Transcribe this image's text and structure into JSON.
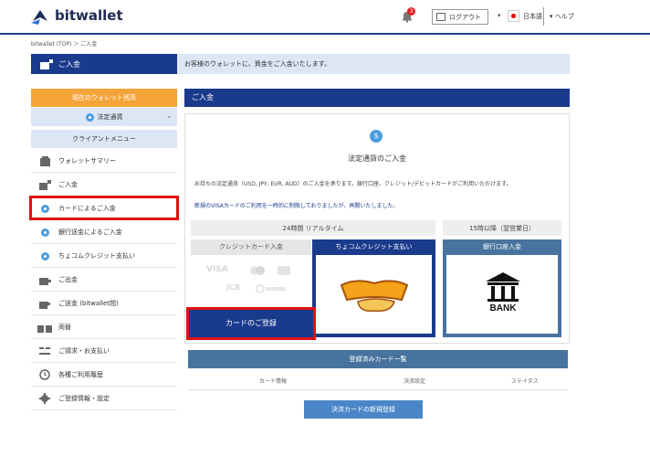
{
  "header": {
    "logo_text": "bitwallet",
    "notification_count": "3",
    "logout_label": "ログアウト",
    "language_label": "日本語",
    "help_label": "ヘルプ"
  },
  "breadcrumb": "bitwallet (TOP) ＞ ご入金",
  "page_banner": {
    "title": "ご入金",
    "message": "お客様のウォレットに、資金をご入金いたします。"
  },
  "sidebar": {
    "wallet_header": "現在のウォレット残高",
    "wallet_selected": "法定通貨",
    "client_menu_header": "クライアントメニュー",
    "items": [
      {
        "label": "ウォレットサマリー",
        "icon": "building-icon"
      },
      {
        "label": "ご入金",
        "icon": "deposit-icon"
      },
      {
        "label": "カードによるご入金",
        "icon": "bullet-icon"
      },
      {
        "label": "銀行送金によるご入金",
        "icon": "bullet-icon"
      },
      {
        "label": "ちょコムクレジット支払い",
        "icon": "bullet-icon"
      },
      {
        "label": "ご出金",
        "icon": "withdraw-icon"
      },
      {
        "label": "ご送金 (bitwallet間)",
        "icon": "transfer-icon"
      },
      {
        "label": "両替",
        "icon": "exchange-icon"
      },
      {
        "label": "ご請求・お支払い",
        "icon": "billing-icon"
      },
      {
        "label": "各種ご利用履歴",
        "icon": "history-icon"
      },
      {
        "label": "ご登録情報・設定",
        "icon": "gear-icon"
      }
    ]
  },
  "main": {
    "title": "ご入金",
    "deposit_heading": "法定通貨のご入金",
    "description": "お持ちの法定通貨（USD, JPY, EUR, AUD）のご入金を承ります。銀行口座、クレジット/デビットカードがご利用いただけます。",
    "notice": "新規のVISAカードのご利用を一時的に制限しておりましたが、再開いたしました。",
    "availability_realtime": "24時間 リアルタイム",
    "availability_bank": "15時以降（翌営業日）",
    "tabs": {
      "card": "クレジットカード入金",
      "choco": "ちょコムクレジット支払い",
      "bank": "銀行口座入金"
    },
    "card_brands": [
      "VISA",
      "JCB"
    ],
    "card_register_button": "カードのご登録",
    "bank_logo_text": "BANK",
    "registered_cards_header": "登録済みカード一覧",
    "registered_cards_columns": [
      "カード情報",
      "決済設定",
      "ステイタス"
    ],
    "new_card_button": "決済カードの新規登録"
  },
  "colors": {
    "navy": "#1a3a8c",
    "orange": "#f5a43a",
    "light_blue": "#dde6f5",
    "highlight_red": "#e01010"
  }
}
